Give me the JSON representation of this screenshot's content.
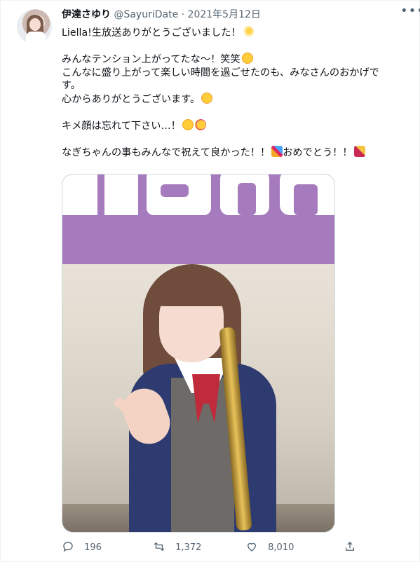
{
  "tweet": {
    "display_name": "伊達さゆり",
    "handle": "@SayuriDate",
    "separator": "·",
    "date": "2021年5月12日",
    "more_icon": "more-horizontal-icon",
    "lines": [
      "Liella!生放送ありがとうございました！",
      "",
      "みんなテンション上がってたな〜！笑笑",
      "こんなに盛り上がって楽しい時間を過ごせたのも、みなさんのおかげで",
      "す。",
      "心からありがとうございます。",
      "",
      "キメ顔は忘れて下さい…！",
      "",
      "なぎちゃんの事もみんなで祝えて良かった！！",
      "おめでとう！！"
    ],
    "emojis": {
      "line0": "dizzy-star-emoji",
      "line2": "rolling-laugh-emoji",
      "line5": "smiling-face-emoji",
      "line7a": "rolling-laugh-emoji",
      "line7b": "kissing-face-emoji",
      "line9": "party-popper-emoji",
      "line10": "lipstick-emoji"
    },
    "media": {
      "banner_text": "Liella",
      "photo_colors": {
        "banner": "#a57bbd",
        "blazer": "#2d3b70",
        "ribbon": "#c02a3a"
      }
    },
    "actions": {
      "reply_count": "196",
      "retweet_count": "1,372",
      "like_count": "8,010"
    }
  }
}
